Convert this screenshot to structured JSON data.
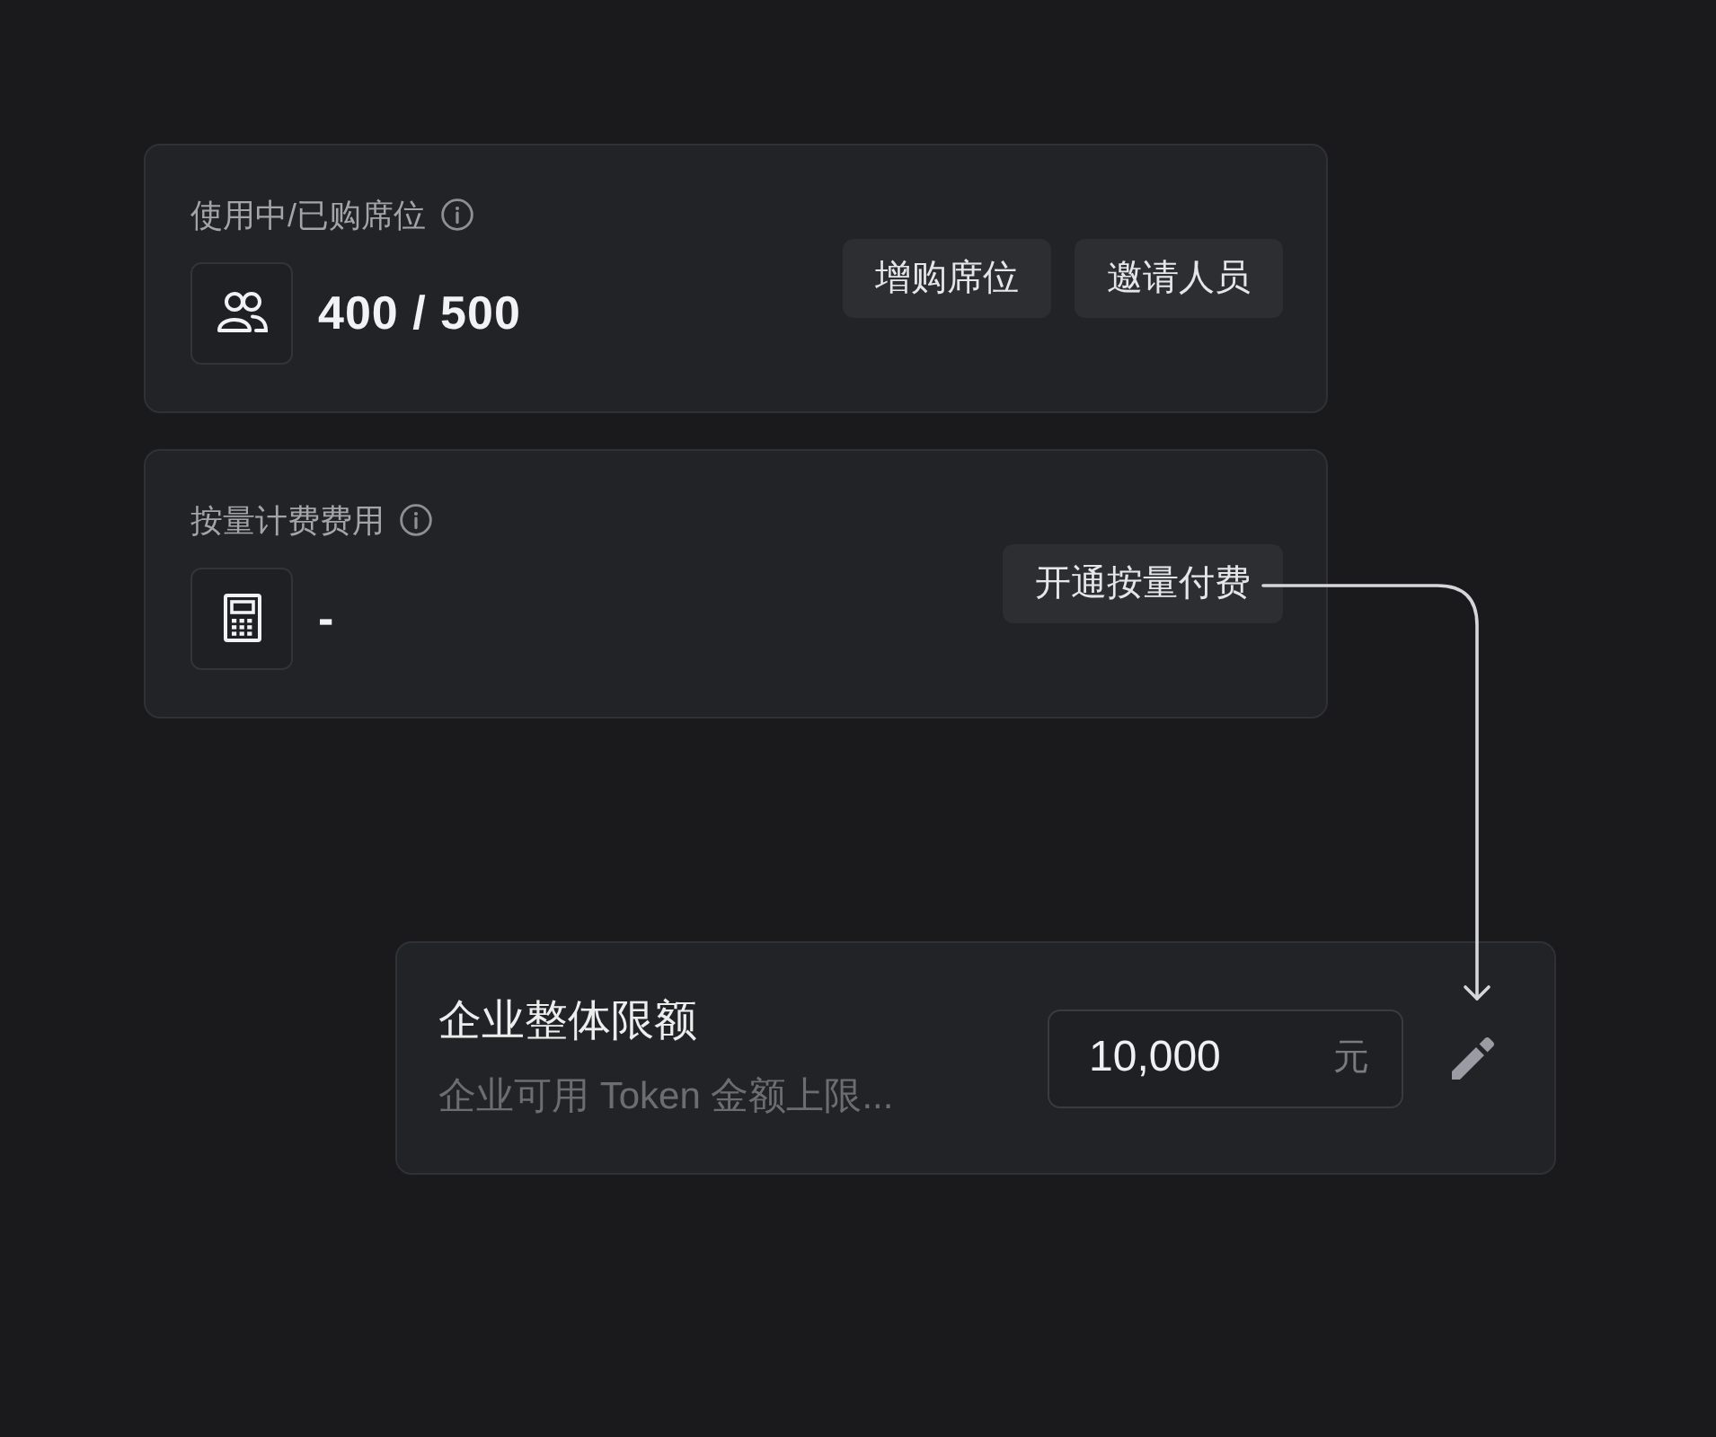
{
  "seat_summary": {
    "label": "使用中/已购席位",
    "value": "400 / 500",
    "buttons": [
      "增购席位",
      "邀请人员"
    ]
  },
  "usage_billing": {
    "label": "按量计费费用",
    "value": "-",
    "buttons": [
      "开通按量付费"
    ]
  },
  "enterprise_limit": {
    "title": "企业整体限额",
    "description": "企业可用 Token 金额上限...",
    "amount": "10,000",
    "unit": "元"
  }
}
